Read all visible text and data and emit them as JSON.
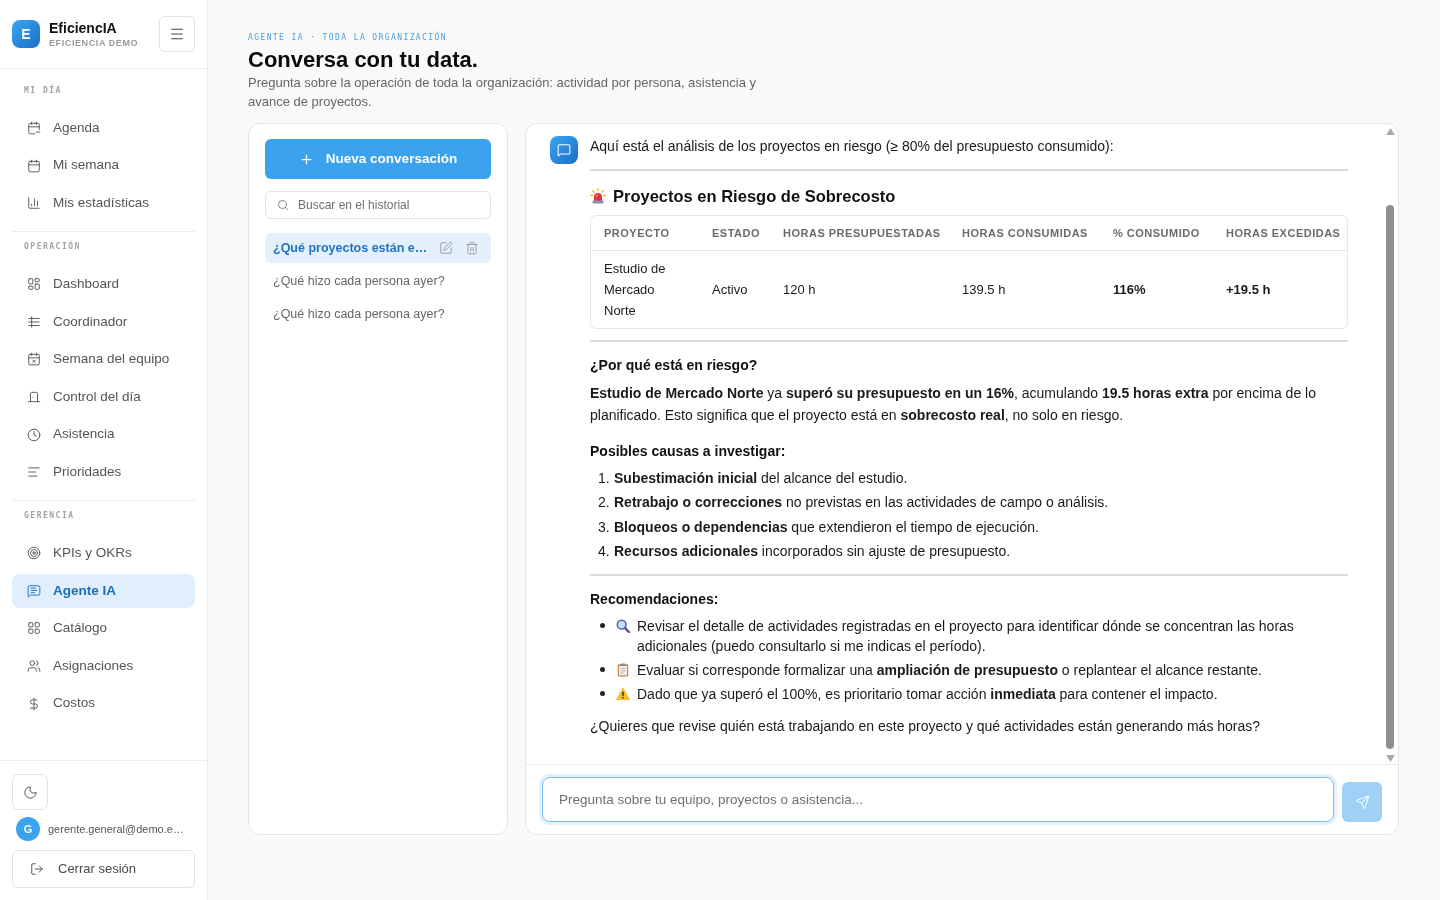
{
  "sidebar": {
    "brand": {
      "logo": "E",
      "name": "EficiencIA",
      "subtitle": "EFICIENCIA DEMO"
    },
    "sections": [
      {
        "title": "MI DÍA",
        "items": [
          {
            "label": "Agenda",
            "selected": false
          },
          {
            "label": "Mi semana",
            "selected": false
          },
          {
            "label": "Mis estadísticas",
            "selected": false
          }
        ]
      },
      {
        "title": "OPERACIÓN",
        "items": [
          {
            "label": "Dashboard",
            "selected": false
          },
          {
            "label": "Coordinador",
            "selected": false
          },
          {
            "label": "Semana del equipo",
            "selected": false
          },
          {
            "label": "Control del día",
            "selected": false
          },
          {
            "label": "Asistencia",
            "selected": false
          },
          {
            "label": "Prioridades",
            "selected": false
          }
        ]
      },
      {
        "title": "GERENCIA",
        "items": [
          {
            "label": "KPIs y OKRs",
            "selected": false
          },
          {
            "label": "Agente IA",
            "selected": true
          },
          {
            "label": "Catálogo",
            "selected": false
          },
          {
            "label": "Asignaciones",
            "selected": false
          },
          {
            "label": "Costos",
            "selected": false
          }
        ]
      }
    ],
    "user": {
      "avatar": "G",
      "email": "gerente.general@demo.e…"
    },
    "logout_button": "Cerrar sesión"
  },
  "header": {
    "eyebrow": "AGENTE IA · TODA LA ORGANIZACIÓN",
    "title": "Conversa con tu data.",
    "description": "Pregunta sobre la operación de toda la organización: actividad por persona, asistencia y avance de proyectos."
  },
  "history": {
    "new_button": "Nueva conversación",
    "search": {
      "placeholder": "Buscar en el historial"
    },
    "items": [
      {
        "label": "¿Qué proyectos están e…",
        "selected": true
      },
      {
        "label": "¿Qué hizo cada persona ayer?",
        "selected": false
      },
      {
        "label": "¿Qué hizo cada persona ayer?",
        "selected": false
      }
    ]
  },
  "chat": {
    "message": {
      "blocks": [
        {
          "kind": "text",
          "text": "Aquí está el análisis de los proyectos en riesgo (≥ 80% del presupuesto consumido):"
        },
        {
          "kind": "rule"
        },
        {
          "kind": "title",
          "text": "Proyectos en Riesgo de Sobrecosto"
        },
        {
          "kind": "table",
          "columns": [
            "PROYECTO",
            "ESTADO",
            "HORAS PRESUPUESTADAS",
            "HORAS CONSUMIDAS",
            "% CONSUMIDO",
            "HORAS EXCEDIDAS"
          ],
          "rows": [
            {
              "cells": [
                {
                  "text": "Estudio de Mercado Norte",
                  "bold": false
                },
                {
                  "text": "Activo",
                  "bold": false
                },
                {
                  "text": "120 h",
                  "bold": false
                },
                {
                  "text": "139.5 h",
                  "bold": false
                },
                {
                  "text": "116%",
                  "bold": true
                },
                {
                  "text": "+19.5 h",
                  "bold": true
                }
              ]
            }
          ]
        },
        {
          "kind": "rule"
        },
        {
          "kind": "heading",
          "text": "¿Por qué está en riesgo?"
        },
        {
          "kind": "paragraph",
          "text": "**Estudio de Mercado Norte** ya **superó su presupuesto en un 16%**, acumulando **19.5 horas extra** por encima de lo planificado. Esto significa que el proyecto está en **sobrecosto real**, no solo en riesgo."
        },
        {
          "kind": "heading",
          "text": "Posibles causas a investigar:"
        },
        {
          "kind": "numbered_list",
          "items": [
            {
              "number": "1.",
              "text": "**Subestimación inicial** del alcance del estudio."
            },
            {
              "number": "2.",
              "text": "**Retrabajo o correcciones** no previstas en las actividades de campo o análisis."
            },
            {
              "number": "3.",
              "text": "**Bloqueos o dependencias** que extendieron el tiempo de ejecución."
            },
            {
              "number": "4.",
              "text": "**Recursos adicionales** incorporados sin ajuste de presupuesto."
            }
          ]
        },
        {
          "kind": "rule"
        },
        {
          "kind": "heading",
          "text": "Recomendaciones:"
        },
        {
          "kind": "bullet_list",
          "items": [
            {
              "text": "Revisar el detalle de actividades registradas en el proyecto para identificar dónde se concentran las horas adicionales (puedo consultarlo si me indicas el período)."
            },
            {
              "text": "Evaluar si corresponde formalizar una **ampliación de presupuesto** o replantear el alcance restante."
            },
            {
              "text": "Dado que ya superó el 100%, es prioritario tomar acción **inmediata** para contener el impacto."
            }
          ]
        },
        {
          "kind": "paragraph",
          "text": "¿Quieres que revise quién está trabajando en este proyecto y qué actividades están generando más horas?"
        }
      ]
    },
    "input": {
      "placeholder": "Pregunta sobre tu equipo, proyectos o asistencia...",
      "focused": true
    },
    "send_button": {
      "disabled": true
    }
  }
}
